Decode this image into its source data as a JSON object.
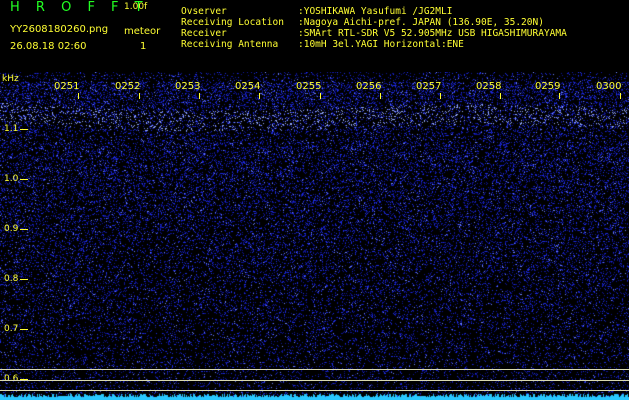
{
  "app": {
    "title": "H R O F F T",
    "version": "1.00f",
    "file_name": "YY2608180260.png",
    "datetime": "26.08.18 02:60",
    "meteor_label": "meteor",
    "meteor_count": "1"
  },
  "info": [
    {
      "key": "Ovserver",
      "value": ":YOSHIKAWA Yasufumi /JG2MLI"
    },
    {
      "key": "Receiving Location",
      "value": ":Nagoya Aichi-pref. JAPAN (136.90E, 35.20N)"
    },
    {
      "key": "Receiver",
      "value": ":SMArt RTL-SDR V5 52.905MHz USB HIGASHIMURAYAMA"
    },
    {
      "key": "Receiving Antenna",
      "value": ":10mH 3el.YAGI Horizontal:ENE"
    }
  ],
  "axis": {
    "unit": "kHz",
    "y_labels": [
      "1.1",
      "1.0",
      "0.9",
      "0.8",
      "0.7",
      "0.6"
    ],
    "time_labels": [
      "0251",
      "0252",
      "0253",
      "0254",
      "0255",
      "0256",
      "0257",
      "0258",
      "0259",
      "0300"
    ]
  },
  "colors": {
    "background": "#000000",
    "noise": "#1a24d8",
    "noise_bright": "#6a7cff",
    "text_yellow": "#ffff33",
    "title_green": "#22ff22",
    "trace": "#29c8ff"
  }
}
